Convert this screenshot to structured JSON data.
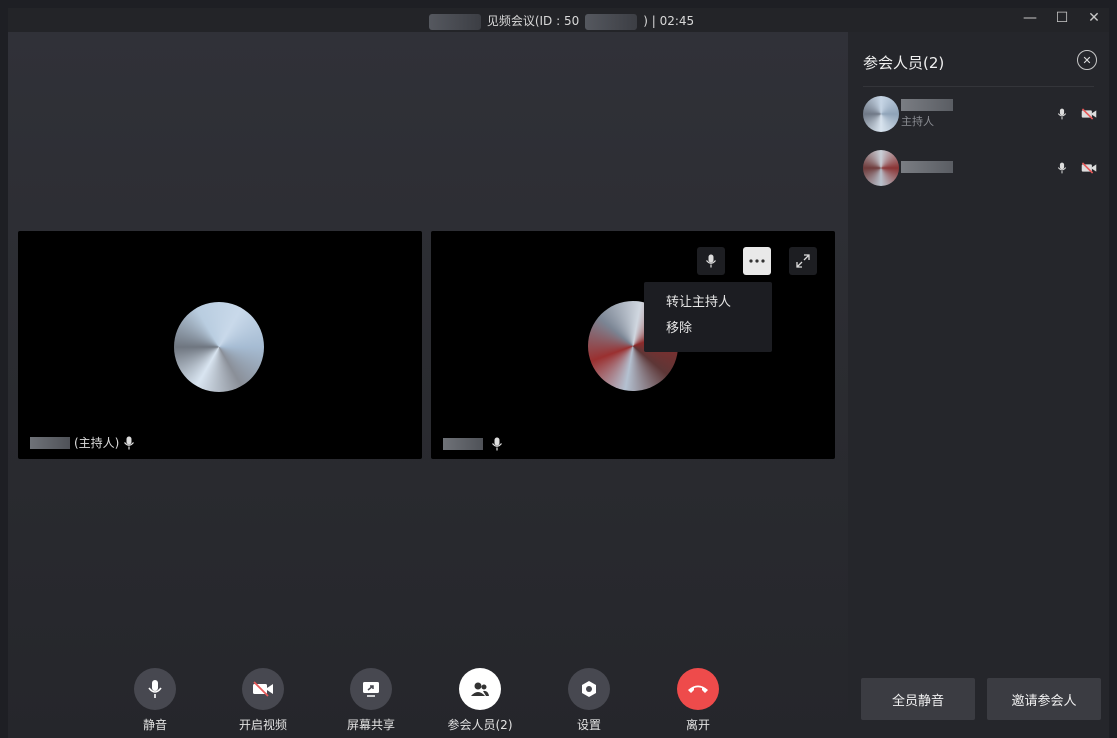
{
  "window": {
    "title_prefix": "见频会议(ID : 50",
    "title_suffix": ") | 02:45",
    "controls": {
      "minimize": "—",
      "maximize": "☐",
      "close": "✕"
    }
  },
  "tiles": [
    {
      "label_suffix": "(主持人)"
    },
    {
      "label_suffix": ""
    }
  ],
  "context_menu": {
    "items": [
      "转让主持人",
      "移除"
    ]
  },
  "toolbar": {
    "mute": "静音",
    "video": "开启视频",
    "share": "屏幕共享",
    "participants": "参会人员(2)",
    "settings": "设置",
    "leave": "离开"
  },
  "panel": {
    "title": "参会人员(2)",
    "participants": [
      {
        "role": "主持人"
      },
      {
        "role": ""
      }
    ],
    "mute_all": "全员静音",
    "invite": "邀请参会人"
  },
  "colors": {
    "leave": "#ee4b4b",
    "video_off": "#e85a5a"
  }
}
